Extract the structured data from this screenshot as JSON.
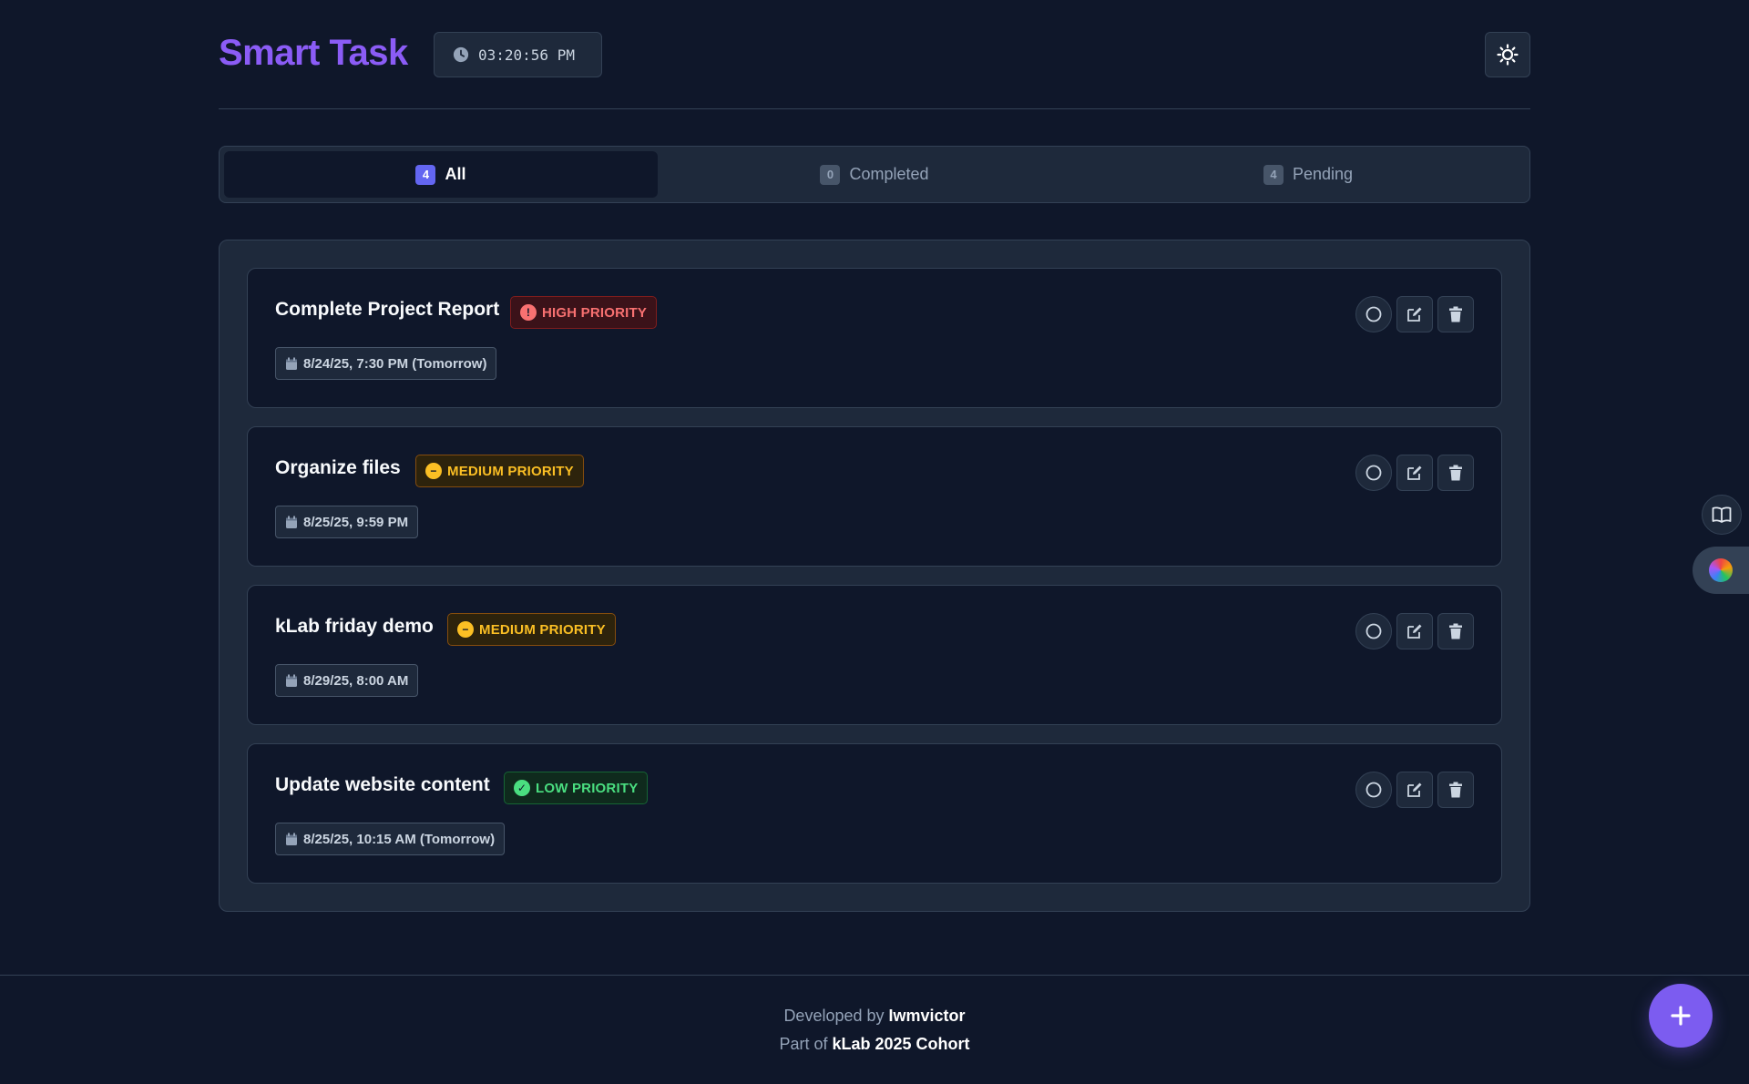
{
  "header": {
    "title": "Smart Task",
    "clock": "03:20:56 PM",
    "settings_icon": "sun-icon"
  },
  "tabs": [
    {
      "label": "All",
      "count": "4",
      "active": true
    },
    {
      "label": "Completed",
      "count": "0",
      "active": false
    },
    {
      "label": "Pending",
      "count": "4",
      "active": false
    }
  ],
  "tasks": [
    {
      "title": "Complete Project Report",
      "priority": "HIGH PRIORITY",
      "priority_level": "high",
      "priority_icon": "!",
      "date": "8/24/25, 7:30 PM (Tomorrow)"
    },
    {
      "title": "Organize files",
      "priority": "MEDIUM PRIORITY",
      "priority_level": "medium",
      "priority_icon": "−",
      "date": "8/25/25, 9:59 PM"
    },
    {
      "title": "kLab friday demo",
      "priority": "MEDIUM PRIORITY",
      "priority_level": "medium",
      "priority_icon": "−",
      "date": "8/29/25, 8:00 AM"
    },
    {
      "title": "Update website content",
      "priority": "LOW PRIORITY",
      "priority_level": "low",
      "priority_icon": "✓",
      "date": "8/25/25, 10:15 AM (Tomorrow)"
    }
  ],
  "footer": {
    "developed_prefix": "Developed by",
    "developer": "Iwmvictor",
    "part_prefix": "Part of",
    "cohort": "kLab 2025 Cohort"
  },
  "fab": {
    "icon": "plus-icon"
  },
  "colors": {
    "background": "#0f172a",
    "surface": "#1e293b",
    "accent": "#8b5cf6",
    "high": "#f87171",
    "medium": "#fbbf24",
    "low": "#4ade80"
  }
}
